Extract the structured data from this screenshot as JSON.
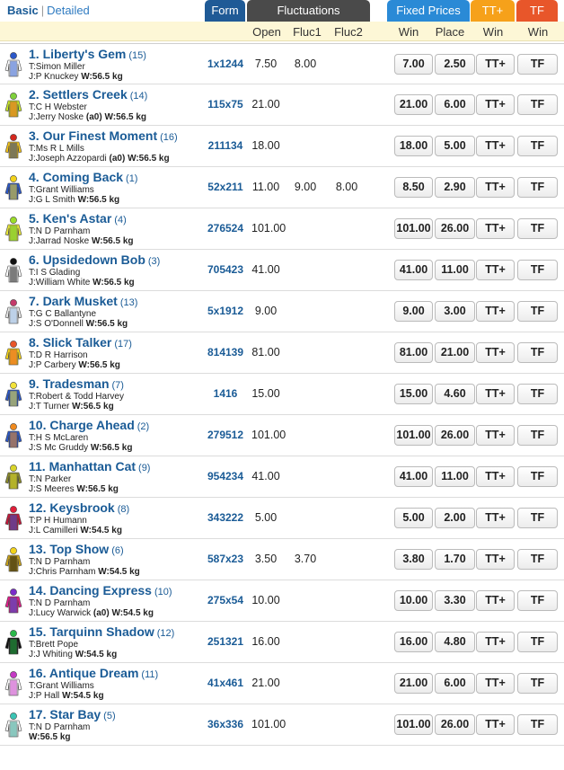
{
  "tabs": {
    "basic": "Basic",
    "separator": "|",
    "detailed": "Detailed"
  },
  "headers": {
    "form": "Form",
    "fluctuations": "Fluctuations",
    "fixed_prices": "Fixed Prices",
    "ttplus": "TT+",
    "tf": "TF"
  },
  "columns": {
    "open": "Open",
    "fluc1": "Fluc1",
    "fluc2": "Fluc2",
    "win": "Win",
    "place": "Place",
    "ttplus_win": "Win",
    "tf_win": "Win"
  },
  "colors": {
    "form_tab": "#1f5a96",
    "fluc_tab": "#4a4a4a",
    "fixed_tab": "#2a8ad6",
    "ttplus_tab": "#f6a11a",
    "tf_tab": "#e8562a",
    "name_link": "#1a5b96"
  },
  "runners": [
    {
      "name": "1. Liberty's Gem",
      "barrier": "(15)",
      "trainer": "T:Simon Miller",
      "jockey": "J:P Knuckey",
      "claim": "",
      "weight": "W:56.5 kg",
      "form": "1x1244",
      "open": "7.50",
      "fluc1": "8.00",
      "fluc2": "",
      "win": "7.00",
      "place": "2.50",
      "tt": "TT+",
      "tf": "TF",
      "silk": [
        "#2b58c9",
        "#ffffff",
        "#2b58c9"
      ]
    },
    {
      "name": "2. Settlers Creek",
      "barrier": "(14)",
      "trainer": "T:C H Webster",
      "jockey": "J:Jerry Noske",
      "claim": "(a0)",
      "weight": "W:56.5 kg",
      "form": "115x75",
      "open": "21.00",
      "fluc1": "",
      "fluc2": "",
      "win": "21.00",
      "place": "6.00",
      "tt": "TT+",
      "tf": "TF",
      "silk": [
        "#7fd13b",
        "#c8e62a",
        "#e85a1f"
      ]
    },
    {
      "name": "3. Our Finest Moment",
      "barrier": "(16)",
      "trainer": "T:Ms R L Mills",
      "jockey": "J:Joseph Azzopardi",
      "claim": "(a0)",
      "weight": "W:56.5 kg",
      "form": "211134",
      "open": "18.00",
      "fluc1": "",
      "fluc2": "",
      "win": "18.00",
      "place": "5.00",
      "tt": "TT+",
      "tf": "TF",
      "silk": [
        "#d4281e",
        "#f2c21b",
        "#1d3a8a"
      ]
    },
    {
      "name": "4. Coming Back",
      "barrier": "(1)",
      "trainer": "T:Grant Williams",
      "jockey": "J:G L Smith",
      "claim": "",
      "weight": "W:56.5 kg",
      "form": "52x211",
      "open": "11.00",
      "fluc1": "9.00",
      "fluc2": "8.00",
      "win": "8.50",
      "place": "2.90",
      "tt": "TT+",
      "tf": "TF",
      "silk": [
        "#f2d21b",
        "#2b58c9",
        "#f2d21b"
      ]
    },
    {
      "name": "5. Ken's Astar",
      "barrier": "(4)",
      "trainer": "T:N D Parnham",
      "jockey": "J:Jarrad Noske",
      "claim": "",
      "weight": "W:56.5 kg",
      "form": "276524",
      "open": "101.00",
      "fluc1": "",
      "fluc2": "",
      "win": "101.00",
      "place": "26.00",
      "tt": "TT+",
      "tf": "TF",
      "silk": [
        "#9bdc2a",
        "#e8e63a",
        "#5cbf2a"
      ]
    },
    {
      "name": "6. Upsidedown Bob",
      "barrier": "(3)",
      "trainer": "T:I S Glading",
      "jockey": "J:William White",
      "claim": "",
      "weight": "W:56.5 kg",
      "form": "705423",
      "open": "41.00",
      "fluc1": "",
      "fluc2": "",
      "win": "41.00",
      "place": "11.00",
      "tt": "TT+",
      "tf": "TF",
      "silk": [
        "#111111",
        "#ffffff",
        "#111111"
      ]
    },
    {
      "name": "7. Dark Musket",
      "barrier": "(13)",
      "trainer": "T:G C Ballantyne",
      "jockey": "J:S O'Donnell",
      "claim": "",
      "weight": "W:56.5 kg",
      "form": "5x1912",
      "open": "9.00",
      "fluc1": "",
      "fluc2": "",
      "win": "9.00",
      "place": "3.00",
      "tt": "TT+",
      "tf": "TF",
      "silk": [
        "#c43a6a",
        "#e8e8e8",
        "#9ac0e8"
      ]
    },
    {
      "name": "8. Slick Talker",
      "barrier": "(17)",
      "trainer": "T:D R Harrison",
      "jockey": "J:P Carbery",
      "claim": "",
      "weight": "W:56.5 kg",
      "form": "814139",
      "open": "81.00",
      "fluc1": "",
      "fluc2": "",
      "win": "81.00",
      "place": "21.00",
      "tt": "TT+",
      "tf": "TF",
      "silk": [
        "#e8562a",
        "#f2d21b",
        "#e8562a"
      ]
    },
    {
      "name": "9. Tradesman",
      "barrier": "(7)",
      "trainer": "T:Robert & Todd Harvey",
      "jockey": "J:T Turner",
      "claim": "",
      "weight": "W:56.5 kg",
      "form": "1416",
      "open": "15.00",
      "fluc1": "",
      "fluc2": "",
      "win": "15.00",
      "place": "4.60",
      "tt": "TT+",
      "tf": "TF",
      "silk": [
        "#f2e23a",
        "#2b58c9",
        "#f2e23a"
      ]
    },
    {
      "name": "10. Charge Ahead",
      "barrier": "(2)",
      "trainer": "T:H S McLaren",
      "jockey": "J:S Mc Gruddy",
      "claim": "",
      "weight": "W:56.5 kg",
      "form": "279512",
      "open": "101.00",
      "fluc1": "",
      "fluc2": "",
      "win": "101.00",
      "place": "26.00",
      "tt": "TT+",
      "tf": "TF",
      "silk": [
        "#f08a1e",
        "#2b58c9",
        "#f08a1e"
      ]
    },
    {
      "name": "11. Manhattan Cat",
      "barrier": "(9)",
      "trainer": "T:N Parker",
      "jockey": "J:S Meeres",
      "claim": "",
      "weight": "W:56.5 kg",
      "form": "954234",
      "open": "41.00",
      "fluc1": "",
      "fluc2": "",
      "win": "41.00",
      "place": "11.00",
      "tt": "TT+",
      "tf": "TF",
      "silk": [
        "#d8d42a",
        "#8a8a2a",
        "#d8d42a"
      ]
    },
    {
      "name": "12. Keysbrook",
      "barrier": "(8)",
      "trainer": "T:P H Humann",
      "jockey": "J:L Camilleri",
      "claim": "",
      "weight": "W:54.5 kg",
      "form": "343222",
      "open": "5.00",
      "fluc1": "",
      "fluc2": "",
      "win": "5.00",
      "place": "2.00",
      "tt": "TT+",
      "tf": "TF",
      "silk": [
        "#e01e3a",
        "#c4183a",
        "#2b58c9"
      ]
    },
    {
      "name": "13. Top Show",
      "barrier": "(6)",
      "trainer": "T:N D Parnham",
      "jockey": "J:Chris Parnham",
      "claim": "",
      "weight": "W:54.5 kg",
      "form": "587x23",
      "open": "3.50",
      "fluc1": "3.70",
      "fluc2": "",
      "win": "3.80",
      "place": "1.70",
      "tt": "TT+",
      "tf": "TF",
      "silk": [
        "#f2d21b",
        "#c8a21b",
        "#111111"
      ]
    },
    {
      "name": "14. Dancing Express",
      "barrier": "(10)",
      "trainer": "T:N D Parnham",
      "jockey": "J:Lucy Warwick",
      "claim": "(a0)",
      "weight": "W:54.5 kg",
      "form": "275x54",
      "open": "10.00",
      "fluc1": "",
      "fluc2": "",
      "win": "10.00",
      "place": "3.30",
      "tt": "TT+",
      "tf": "TF",
      "silk": [
        "#7a2bc9",
        "#e01e8a",
        "#2b58c9"
      ]
    },
    {
      "name": "15. Tarquinn Shadow",
      "barrier": "(12)",
      "trainer": "T:Brett Pope",
      "jockey": "J:J Whiting",
      "claim": "",
      "weight": "W:54.5 kg",
      "form": "251321",
      "open": "16.00",
      "fluc1": "",
      "fluc2": "",
      "win": "16.00",
      "place": "4.80",
      "tt": "TT+",
      "tf": "TF",
      "silk": [
        "#2ab84a",
        "#111111",
        "#2ab84a"
      ]
    },
    {
      "name": "16. Antique Dream",
      "barrier": "(11)",
      "trainer": "T:Grant Williams",
      "jockey": "J:P Hall",
      "claim": "",
      "weight": "W:54.5 kg",
      "form": "41x461",
      "open": "21.00",
      "fluc1": "",
      "fluc2": "",
      "win": "21.00",
      "place": "6.00",
      "tt": "TT+",
      "tf": "TF",
      "silk": [
        "#c43ac4",
        "#ffffff",
        "#c43ac4"
      ]
    },
    {
      "name": "17. Star Bay",
      "barrier": "(5)",
      "trainer": "T:N D Parnham",
      "jockey": "",
      "claim": "",
      "weight": "W:56.5 kg",
      "form": "36x336",
      "open": "101.00",
      "fluc1": "",
      "fluc2": "",
      "win": "101.00",
      "place": "26.00",
      "tt": "TT+",
      "tf": "TF",
      "silk": [
        "#3ac4b4",
        "#ffffff",
        "#2a9a8a"
      ]
    }
  ]
}
